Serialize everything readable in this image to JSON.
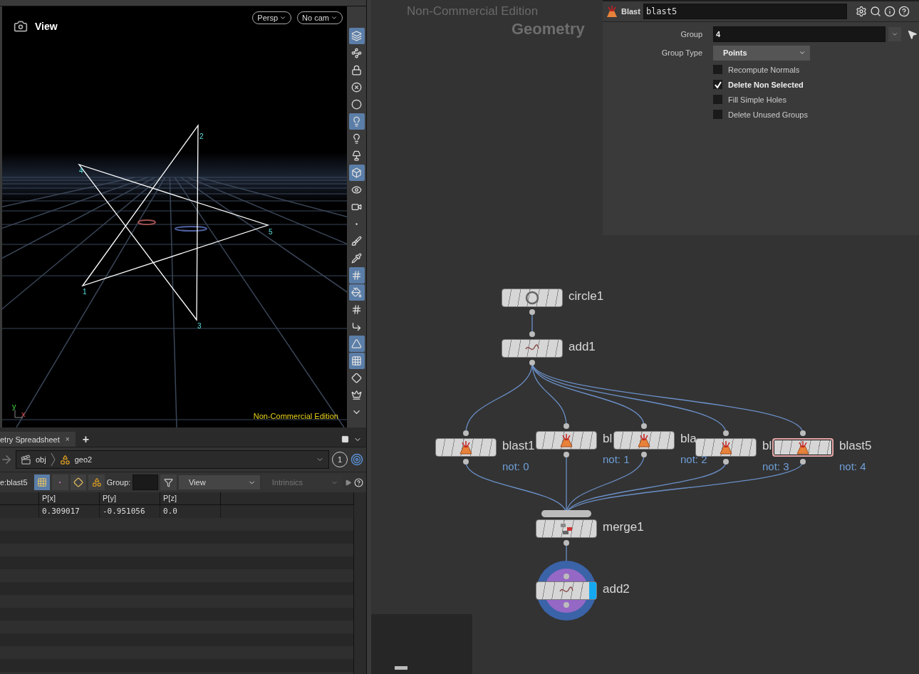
{
  "viewport": {
    "title": "View",
    "camera_buttons": [
      "Persp",
      "No cam"
    ],
    "watermark": "Non-Commercial Edition",
    "axis": {
      "y": "y",
      "x": "x"
    },
    "points": [
      "1",
      "2",
      "3",
      "4",
      "5"
    ],
    "toolbar": [
      {
        "selected": true
      },
      {
        "selected": false
      },
      {
        "selected": false
      },
      {
        "selected": false
      },
      {
        "selected": false
      },
      {
        "selected": true
      },
      {
        "selected": false
      },
      {
        "selected": false
      },
      {
        "selected": true
      },
      {
        "selected": false
      },
      {
        "selected": false
      },
      {
        "selected": false
      },
      {
        "selected": false
      },
      {
        "selected": false
      },
      {
        "selected": true
      },
      {
        "selected": true
      },
      {
        "selected": false
      },
      {
        "selected": false
      },
      {
        "selected": true
      },
      {
        "selected": true
      },
      {
        "selected": false
      },
      {
        "selected": false
      },
      {
        "selected": false
      }
    ]
  },
  "spreadsheet": {
    "tabs": [
      {
        "label": "etry Spreadsheet",
        "close": "×",
        "selected": true
      }
    ],
    "add_tab": "+",
    "path": [
      "obj",
      "geo2"
    ],
    "view_count": "1",
    "node": "e:blast5",
    "group_label": "Group:",
    "dropdowns": [
      {
        "label": "View",
        "disabled": false
      },
      {
        "label": "Intrinsics",
        "disabled": true
      }
    ],
    "columns": [
      "P[x]",
      "P[y]",
      "P[z]"
    ],
    "rows": [
      [
        "0.309017",
        "-0.951056",
        "0.0"
      ]
    ]
  },
  "network": {
    "watermark": "Non-Commercial Edition",
    "context": "Geometry",
    "nodes": [
      {
        "kind": "circle",
        "label": "circle1",
        "selected": false,
        "display": false
      },
      {
        "kind": "add",
        "label": "add1",
        "selected": false,
        "display": false
      },
      {
        "kind": "blast",
        "label": "blast1",
        "note": "not: 0",
        "selected": false,
        "display": false
      },
      {
        "kind": "blast",
        "label": "bl",
        "note": "not: 1",
        "selected": false,
        "display": false
      },
      {
        "kind": "blast",
        "label": "bla",
        "note": "not: 2",
        "selected": false,
        "display": false
      },
      {
        "kind": "blast",
        "label": "bl",
        "note": "not: 3",
        "selected": false,
        "display": false
      },
      {
        "kind": "blast",
        "label": "blast5",
        "note": "not: 4",
        "selected": true,
        "display": false
      },
      {
        "kind": "merge",
        "label": "merge1",
        "selected": false,
        "display": false
      },
      {
        "kind": "add",
        "label": "add2",
        "selected": false,
        "display": true
      }
    ]
  },
  "parameters": {
    "type": "Blast",
    "name": "blast5",
    "fields": [
      {
        "kind": "text",
        "label": "Group",
        "value": "4"
      },
      {
        "kind": "menu",
        "label": "Group Type",
        "value": "Points"
      }
    ],
    "toggles": [
      {
        "label": "Recompute Normals",
        "checked": false
      },
      {
        "label": "Delete Non Selected",
        "checked": true
      },
      {
        "label": "Fill Simple Holes",
        "checked": false
      },
      {
        "label": "Delete Unused Groups",
        "checked": false
      }
    ]
  }
}
